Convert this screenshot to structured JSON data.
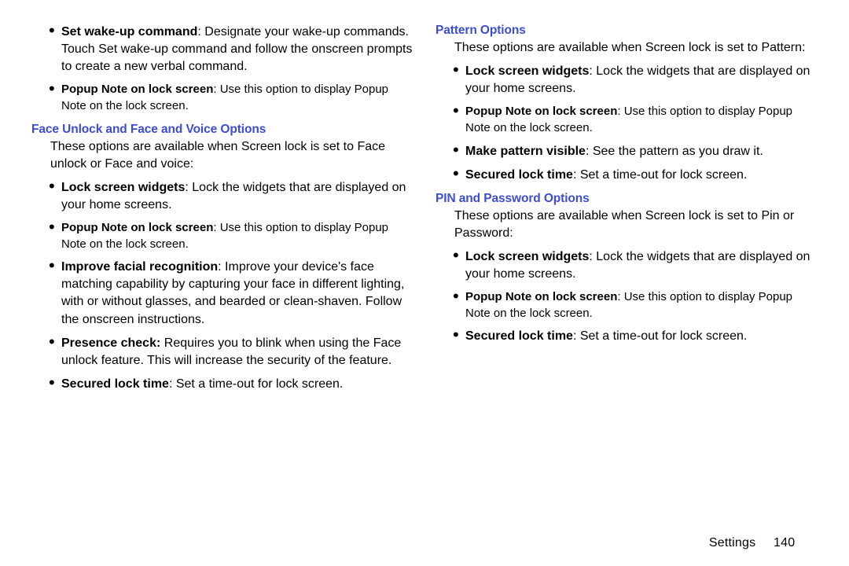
{
  "col1": {
    "top_bullets": [
      {
        "bold": "Set wake-up command",
        "text": ": Designate your wake-up commands. Touch Set wake-up command and follow the onscreen prompts to create a new verbal command.",
        "small": false
      },
      {
        "bold": "Popup Note on lock screen",
        "text": ": Use this option to display Popup Note on the lock screen.",
        "small": true
      }
    ],
    "section": {
      "heading": "Face Unlock and Face and Voice Options",
      "intro": "These options are available when Screen lock is set to Face unlock or Face and voice:",
      "bullets": [
        {
          "bold": "Lock screen widgets",
          "text": ": Lock the widgets that are displayed on your home screens.",
          "small": false
        },
        {
          "bold": "Popup Note on lock screen",
          "text": ": Use this option to display Popup Note on the lock screen.",
          "small": true
        },
        {
          "bold": "Improve facial recognition",
          "text": ": Improve your device's face matching capability by capturing your face in different lighting, with or without glasses, and bearded or clean-shaven. Follow the onscreen instructions.",
          "small": false
        },
        {
          "bold": "Presence check:",
          "text": " Requires you to blink when using the Face unlock feature. This will increase the security of the feature.",
          "small": false
        },
        {
          "bold": "Secured lock time",
          "text": ": Set a time-out for lock screen.",
          "small": false
        }
      ]
    }
  },
  "col2": {
    "section1": {
      "heading": "Pattern Options",
      "intro": "These options are available when Screen lock is set to Pattern:",
      "bullets": [
        {
          "bold": "Lock screen widgets",
          "text": ": Lock the widgets that are displayed on your home screens.",
          "small": false
        },
        {
          "bold": "Popup Note on lock screen",
          "text": ": Use this option to display Popup Note on the lock screen.",
          "small": true
        },
        {
          "bold": "Make pattern visible",
          "text": ": See the pattern as you draw it.",
          "small": false
        },
        {
          "bold": "Secured lock time",
          "text": ": Set a time-out for lock screen.",
          "small": false
        }
      ]
    },
    "section2": {
      "heading": "PIN and Password Options",
      "intro": "These options are available when Screen lock is set to Pin or Password:",
      "bullets": [
        {
          "bold": "Lock screen widgets",
          "text": ": Lock the widgets that are displayed on your home screens.",
          "small": false
        },
        {
          "bold": "Popup Note on lock screen",
          "text": ": Use this option to display Popup Note on the lock screen.",
          "small": true
        },
        {
          "bold": "Secured lock time",
          "text": ": Set a time-out for lock screen.",
          "small": false
        }
      ]
    }
  },
  "footer": {
    "label": "Settings",
    "page": "140"
  }
}
